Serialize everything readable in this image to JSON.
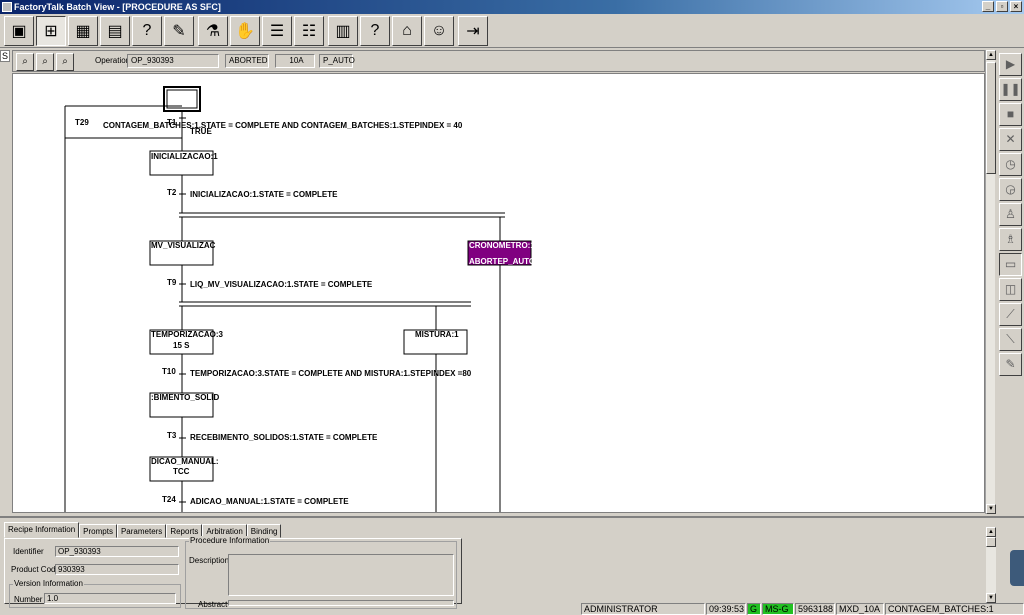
{
  "window": {
    "title": "FactoryTalk Batch View - [PROCEDURE AS SFC]"
  },
  "toolbar": {
    "buttons": [
      "view-icon",
      "sfc-icon",
      "table-icon",
      "report-icon",
      "help-doc-icon",
      "sign-icon",
      "recipe-icon",
      "handshake-icon",
      "list-icon",
      "list-edit-icon",
      "chart-icon",
      "help-icon",
      "equipment-icon",
      "user-icon",
      "exit-icon"
    ]
  },
  "left_tab": "S",
  "header": {
    "operation_label": "Operation",
    "operation_value": "OP_930393",
    "state": "ABORTED",
    "unit": "10A",
    "mode": "P_AUTO"
  },
  "sfc": {
    "transitions": [
      {
        "id": "T29",
        "text": "CONTAGEM_BATCHES:1.STATE = COMPLETE AND CONTAGEM_BATCHES:1.STEPINDEX = 40"
      },
      {
        "id": "T1",
        "text": "TRUE"
      },
      {
        "id": "T2",
        "text": "INICIALIZACAO:1.STATE = COMPLETE"
      },
      {
        "id": "T9",
        "text": "LIQ_MV_VISUALIZACAO:1.STATE = COMPLETE"
      },
      {
        "id": "T10",
        "text": "TEMPORIZACAO:3.STATE = COMPLETE AND MISTURA:1.STEPINDEX =80"
      },
      {
        "id": "T3",
        "text": "RECEBIMENTO_SOLIDOS:1.STATE = COMPLETE"
      },
      {
        "id": "T24",
        "text": "ADICAO_MANUAL:1.STATE = COMPLETE"
      }
    ],
    "steps": [
      {
        "name": "INICIALIZACAO:1",
        "sub": ""
      },
      {
        "name": "MV_VISUALIZAC",
        "sub": ""
      },
      {
        "name": "CRONOMETRO:1",
        "sub": "ABORTEP_AUTO",
        "highlight": true
      },
      {
        "name": "TEMPORIZACAO:3",
        "sub": "15 S"
      },
      {
        "name": "MISTURA:1",
        "sub": ""
      },
      {
        "name": ":BIMENTO_SOLID",
        "sub": ""
      },
      {
        "name": "DICAO_MANUAL:",
        "sub": "TCC"
      }
    ]
  },
  "bottom": {
    "tabs": [
      "Recipe Information",
      "Prompts",
      "Parameters",
      "Reports",
      "Arbitration",
      "Binding"
    ],
    "identifier_label": "Identifier",
    "identifier_value": "OP_930393",
    "product_code_label": "Product Code",
    "product_code_value": "930393",
    "version_group_label": "Version Information",
    "number_label": "Number",
    "number_value": "1.0",
    "procedure_group_label": "Procedure Information",
    "description_label": "Description",
    "abstract_label": "Abstract"
  },
  "status": {
    "user": "ADMINISTRATOR",
    "time": "09:39:53",
    "g": "G",
    "server": "MS-G",
    "batch": "5963188",
    "area": "MXD_10A",
    "phase": "CONTAGEM_BATCHES:1"
  },
  "colors": {
    "highlight": "#800080",
    "status_green": "#22c022"
  }
}
